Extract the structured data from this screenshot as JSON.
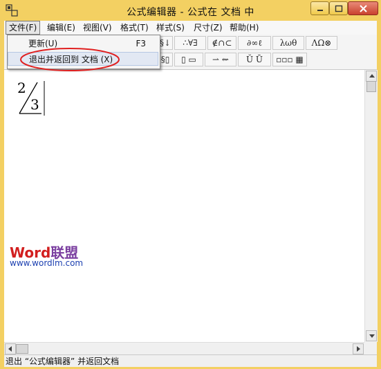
{
  "window": {
    "title": "公式编辑器 - 公式在 文档 中"
  },
  "menubar": {
    "items": [
      {
        "label": "文件(F)"
      },
      {
        "label": "编辑(E)"
      },
      {
        "label": "视图(V)"
      },
      {
        "label": "格式(T)"
      },
      {
        "label": "样式(S)"
      },
      {
        "label": "尺寸(Z)"
      },
      {
        "label": "帮助(H)"
      }
    ]
  },
  "file_menu": {
    "items": [
      {
        "label": "更新(U)",
        "shortcut": "F3"
      },
      {
        "label": "退出并返回到 文档 (X)",
        "shortcut": ""
      }
    ]
  },
  "toolbar": {
    "row1": [
      {
        "label": "§↓"
      },
      {
        "label": "∴∀∃"
      },
      {
        "label": "∉∩⊂"
      },
      {
        "label": "∂∞ℓ"
      },
      {
        "label": "λωθ"
      },
      {
        "label": "ΛΩ⊗"
      }
    ],
    "row2": [
      {
        "label": "§▯"
      },
      {
        "label": "▯ ▭"
      },
      {
        "label": "⇀ ⇜"
      },
      {
        "label": "Ŭ Ū"
      },
      {
        "label": "▫▫▫ ▦"
      }
    ]
  },
  "document": {
    "equation": {
      "numerator": "2",
      "denominator": "3"
    },
    "watermark": {
      "logo_word": "Word",
      "logo_cn": "联盟",
      "url": "www.wordlm.com"
    }
  },
  "statusbar": {
    "text": "退出 “公式编辑器” 并返回文档"
  },
  "colors": {
    "title_bar": "#f3d062",
    "close_button": "#c9412e",
    "annotation_circle": "#e02020",
    "watermark_red": "#d21f1f",
    "watermark_purple": "#7b3fa0",
    "watermark_url": "#1b3fb0"
  }
}
